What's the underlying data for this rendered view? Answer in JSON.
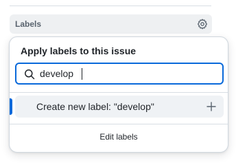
{
  "sidebar": {
    "labels_header": "Labels",
    "settings_icon": "gear-icon"
  },
  "popover": {
    "title": "Apply labels to this issue",
    "search": {
      "value": "develop",
      "icon": "search-icon"
    },
    "create_row": {
      "label": "Create new label: \"develop\"",
      "icon": "plus-icon"
    },
    "footer": {
      "edit_labels": "Edit labels"
    }
  },
  "colors": {
    "accent": "#0969da",
    "header_bg": "#eef0f2",
    "row_bg": "#eff2f5",
    "text": "#1f2328",
    "muted": "#59636e"
  }
}
